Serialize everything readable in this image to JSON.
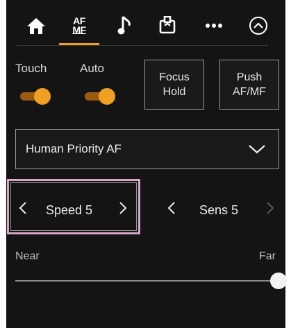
{
  "tabs": [
    {
      "icon": "home-icon"
    },
    {
      "icon": "af-mf-icon",
      "line1": "AF",
      "line2": "MF",
      "active": true
    },
    {
      "icon": "music-note-icon"
    },
    {
      "icon": "card-tab-icon"
    },
    {
      "icon": "more-icon"
    },
    {
      "icon": "chevron-up-circle-icon"
    }
  ],
  "accent_color": "#f0a020",
  "toggles": {
    "touch": {
      "label": "Touch",
      "on": true
    },
    "auto": {
      "label": "Auto",
      "on": true
    }
  },
  "buttons": {
    "focus_hold": {
      "line1": "Focus",
      "line2": "Hold"
    },
    "push_af_mf": {
      "line1": "Push",
      "line2": "AF/MF"
    }
  },
  "dropdown": {
    "value": "Human Priority AF"
  },
  "steppers": {
    "speed": {
      "value": "Speed 5"
    },
    "sens": {
      "value": "Sens 5"
    }
  },
  "highlight_color": "#d9a6c8",
  "slider": {
    "min_label": "Near",
    "max_label": "Far",
    "position": 1.0
  }
}
